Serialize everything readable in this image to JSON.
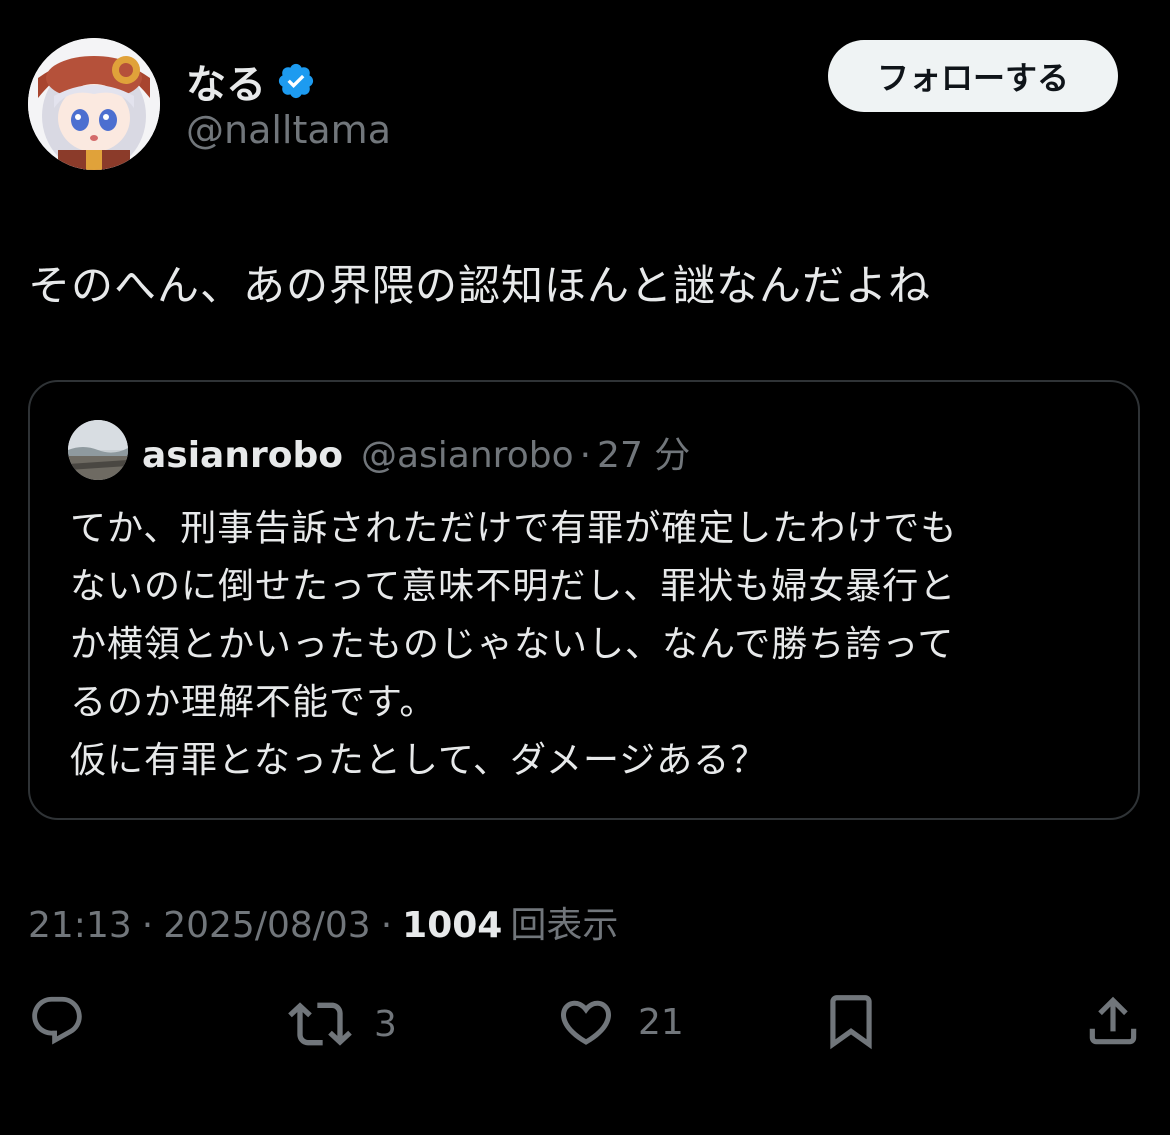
{
  "author": {
    "display_name": "なる",
    "handle": "@nalltama",
    "verified_icon": "verified-badge-icon",
    "verified_color": "#1d9bf0"
  },
  "follow_label": "フォローする",
  "tweet_text": "そのへん、あの界隈の認知ほんと謎なんだよね",
  "quote": {
    "name": "asianrobo",
    "handle": "@asianrobo",
    "separator": "·",
    "time": "27 分",
    "lines": [
      "てか、刑事告訴されただけで有罪が確定したわけでも",
      "ないのに倒せたって意味不明だし、罪状も婦女暴行と",
      "か横領とかいったものじゃないし、なんで勝ち誇って",
      "るのか理解不能です。",
      "仮に有罪となったとして、ダメージある？"
    ]
  },
  "meta": {
    "time": "21:13",
    "separator": "·",
    "date": "2025/08/03",
    "views_count": "1004",
    "views_label": "回表示"
  },
  "actions": {
    "reply": {
      "icon": "reply-icon"
    },
    "retweet": {
      "icon": "retweet-icon",
      "count": "3"
    },
    "like": {
      "icon": "heart-icon",
      "count": "21"
    },
    "bookmark": {
      "icon": "bookmark-icon"
    },
    "share": {
      "icon": "share-icon"
    }
  },
  "colors": {
    "background": "#000000",
    "text": "#e7e9ea",
    "secondary_text": "#71767b",
    "border": "#2f3336",
    "follow_button_bg": "#eff3f4"
  }
}
